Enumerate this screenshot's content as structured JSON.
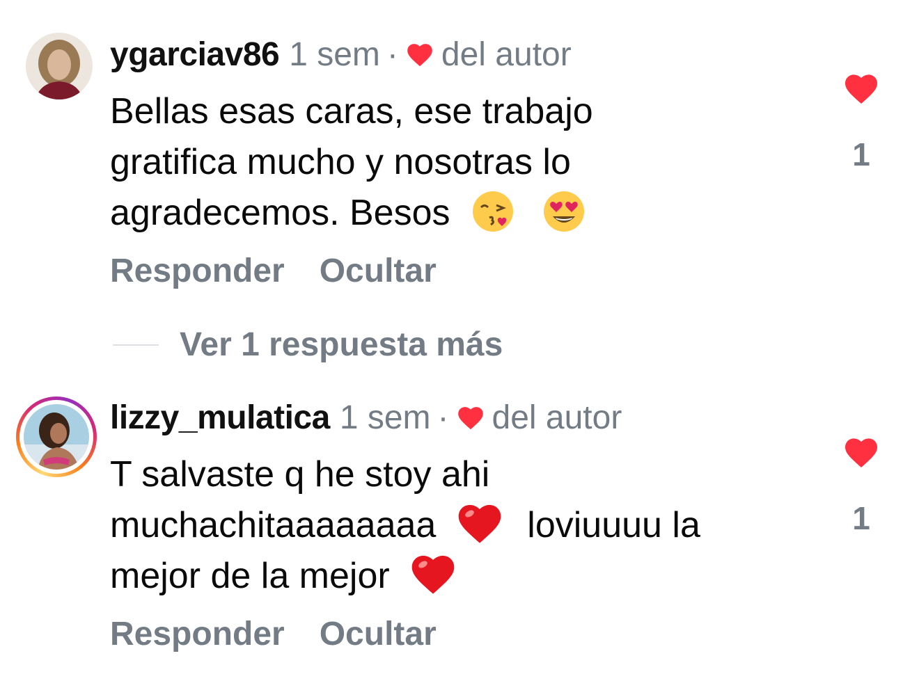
{
  "comments": [
    {
      "username": "ygarciav86",
      "time": "1 sem",
      "separator": "·",
      "author_like_label": "del autor",
      "text_lines": [
        "Bellas esas caras,  ese trabajo",
        "gratifica mucho y nosotras lo",
        "agradecemos. Besos"
      ],
      "emojis": [
        "face-blowing-kiss",
        "smiling-face-heart-eyes"
      ],
      "like_count": "1",
      "reply_label": "Responder",
      "hide_label": "Ocultar",
      "avatar_story_ring": false
    },
    {
      "username": "lizzy_mulatica",
      "time": "1 sem",
      "separator": "·",
      "author_like_label": "del autor",
      "text_lines": [
        "T salvaste q he stoy ahi",
        "muchachitaaaaaaaa",
        "loviuuuu la",
        "mejor de la mejor"
      ],
      "emojis": [
        "red-heart",
        "red-heart"
      ],
      "like_count": "1",
      "reply_label": "Responder",
      "hide_label": "Ocultar",
      "avatar_story_ring": true
    }
  ],
  "view_more_replies": "Ver 1 respuesta más",
  "colors": {
    "like_red": "#ff3040",
    "secondary_text": "#737c85",
    "primary_text": "#0a0a0a"
  }
}
